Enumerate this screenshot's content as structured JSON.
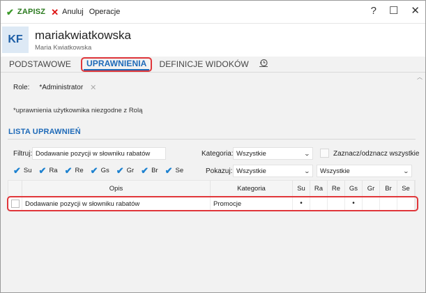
{
  "toolbar": {
    "save_label": "ZAPISZ",
    "cancel_label": "Anuluj",
    "operations_label": "Operacje",
    "help_label": "?",
    "maximize_label": "☐",
    "close_label": "✕"
  },
  "user": {
    "initials": "KF",
    "login": "mariakwiatkowska",
    "full_name": "Maria Kwiatkowska"
  },
  "tabs": [
    {
      "label": "PODSTAWOWE"
    },
    {
      "label": "UPRAWNIENIA"
    },
    {
      "label": "DEFINICJE WIDOKÓW"
    }
  ],
  "roles": {
    "label": "Role:",
    "value": "*Administrator"
  },
  "note": "*uprawnienia użytkownika niezgodne z Rolą",
  "section_title": "LISTA UPRAWNIEŃ",
  "filters": {
    "filter_label": "Filtruj:",
    "filter_value": "Dodawanie pozycji w słowniku rabatów",
    "category_label": "Kategoria:",
    "category_value": "Wszystkie",
    "toggle_all_label": "Zaznacz/odznacz wszystkie",
    "show_label": "Pokazuj:",
    "show_value": "Wszystkie",
    "show_value2": "Wszystkie"
  },
  "days": [
    "Su",
    "Ra",
    "Re",
    "Gs",
    "Gr",
    "Br",
    "Se"
  ],
  "table": {
    "headers": {
      "opis": "Opis",
      "kategoria": "Kategoria",
      "days": [
        "Su",
        "Ra",
        "Re",
        "Gs",
        "Gr",
        "Br",
        "Se"
      ]
    },
    "rows": [
      {
        "opis": "Dodawanie pozycji w słowniku rabatów",
        "kategoria": "Promocje",
        "days": [
          "•",
          "",
          "",
          "•",
          "",
          "",
          ""
        ]
      }
    ]
  },
  "colors": {
    "accent": "#1e6ab8",
    "highlight": "#e0363a",
    "save_green": "#2a7a1e"
  },
  "icons": {
    "save": "check-icon",
    "cancel": "x-icon",
    "history": "history-icon",
    "chevron": "chevron-down-icon"
  }
}
